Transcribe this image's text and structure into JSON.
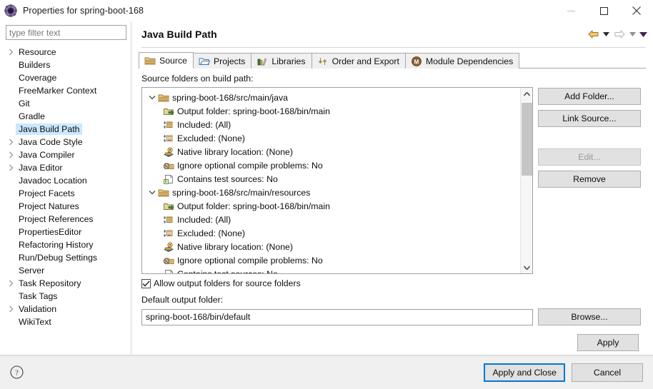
{
  "window": {
    "title": "Properties for spring-boot-168",
    "icon": "properties-gear-icon",
    "minimize_label": "—",
    "maximize_label": "□",
    "close_label": "✕"
  },
  "sidebar": {
    "filter": {
      "placeholder": "type filter text",
      "value": ""
    },
    "items": [
      {
        "label": "Resource",
        "expandable": true,
        "selected": false
      },
      {
        "label": "Builders",
        "expandable": false,
        "selected": false
      },
      {
        "label": "Coverage",
        "expandable": false,
        "selected": false
      },
      {
        "label": "FreeMarker Context",
        "expandable": false,
        "selected": false
      },
      {
        "label": "Git",
        "expandable": false,
        "selected": false
      },
      {
        "label": "Gradle",
        "expandable": false,
        "selected": false
      },
      {
        "label": "Java Build Path",
        "expandable": false,
        "selected": true
      },
      {
        "label": "Java Code Style",
        "expandable": true,
        "selected": false
      },
      {
        "label": "Java Compiler",
        "expandable": true,
        "selected": false
      },
      {
        "label": "Java Editor",
        "expandable": true,
        "selected": false
      },
      {
        "label": "Javadoc Location",
        "expandable": false,
        "selected": false
      },
      {
        "label": "Project Facets",
        "expandable": false,
        "selected": false
      },
      {
        "label": "Project Natures",
        "expandable": false,
        "selected": false
      },
      {
        "label": "Project References",
        "expandable": false,
        "selected": false
      },
      {
        "label": "PropertiesEditor",
        "expandable": false,
        "selected": false
      },
      {
        "label": "Refactoring History",
        "expandable": false,
        "selected": false
      },
      {
        "label": "Run/Debug Settings",
        "expandable": false,
        "selected": false
      },
      {
        "label": "Server",
        "expandable": false,
        "selected": false
      },
      {
        "label": "Task Repository",
        "expandable": true,
        "selected": false
      },
      {
        "label": "Task Tags",
        "expandable": false,
        "selected": false
      },
      {
        "label": "Validation",
        "expandable": true,
        "selected": false
      },
      {
        "label": "WikiText",
        "expandable": false,
        "selected": false
      }
    ]
  },
  "content": {
    "page_title": "Java Build Path",
    "nav": {
      "back_icon": "back-arrow-icon",
      "back_menu_icon": "chevron-down-icon",
      "forward_icon": "forward-arrow-icon",
      "forward_menu_icon": "chevron-down-icon",
      "history_icon": "chevron-down-filled-icon"
    },
    "tabs": [
      {
        "label": "Source",
        "icon": "source-folder-icon",
        "active": true
      },
      {
        "label": "Projects",
        "icon": "project-folder-icon",
        "active": false
      },
      {
        "label": "Libraries",
        "icon": "libraries-books-icon",
        "active": false
      },
      {
        "label": "Order and Export",
        "icon": "order-arrows-icon",
        "active": false
      },
      {
        "label": "Module Dependencies",
        "icon": "module-circle-icon",
        "active": false
      }
    ],
    "panel_label": "Source folders on build path:",
    "tree": [
      {
        "label": "spring-boot-168/src/main/java",
        "icon": "source-folder-icon",
        "expanded": true,
        "children": [
          {
            "label": "Output folder: spring-boot-168/bin/main",
            "icon": "output-folder-icon"
          },
          {
            "label": "Included: (All)",
            "icon": "included-filter-icon"
          },
          {
            "label": "Excluded: (None)",
            "icon": "excluded-filter-icon"
          },
          {
            "label": "Native library location: (None)",
            "icon": "native-library-icon"
          },
          {
            "label": "Ignore optional compile problems: No",
            "icon": "ignore-problems-icon"
          },
          {
            "label": "Contains test sources: No",
            "icon": "test-sources-icon"
          }
        ]
      },
      {
        "label": "spring-boot-168/src/main/resources",
        "icon": "source-folder-icon",
        "expanded": true,
        "children": [
          {
            "label": "Output folder: spring-boot-168/bin/main",
            "icon": "output-folder-icon"
          },
          {
            "label": "Included: (All)",
            "icon": "included-filter-icon"
          },
          {
            "label": "Excluded: (None)",
            "icon": "excluded-filter-icon"
          },
          {
            "label": "Native library location: (None)",
            "icon": "native-library-icon"
          },
          {
            "label": "Ignore optional compile problems: No",
            "icon": "ignore-problems-icon"
          },
          {
            "label": "Contains test sources: No",
            "icon": "test-sources-icon"
          }
        ]
      }
    ],
    "scrollbar": {
      "up_icon": "chevron-up-icon",
      "down_icon": "chevron-down-icon",
      "thumb_percent": 45
    },
    "side_buttons": [
      {
        "label": "Add Folder...",
        "disabled": false
      },
      {
        "label": "Link Source...",
        "disabled": false
      },
      {
        "label": "Edit...",
        "disabled": true
      },
      {
        "label": "Remove",
        "disabled": false
      }
    ],
    "allow_output_checkbox": {
      "label": "Allow output folders for source folders",
      "checked": true
    },
    "default_output": {
      "label": "Default output folder:",
      "value": "spring-boot-168/bin/default",
      "browse_label": "Browse..."
    },
    "apply_label": "Apply"
  },
  "footer": {
    "help_icon": "help-question-icon",
    "apply_and_close_label": "Apply and Close",
    "cancel_label": "Cancel"
  },
  "colors": {
    "selection": "#cce8ff",
    "accent": "#0078d7",
    "button_face": "#e1e1e1",
    "dialog_bg": "#f0f0f0"
  }
}
